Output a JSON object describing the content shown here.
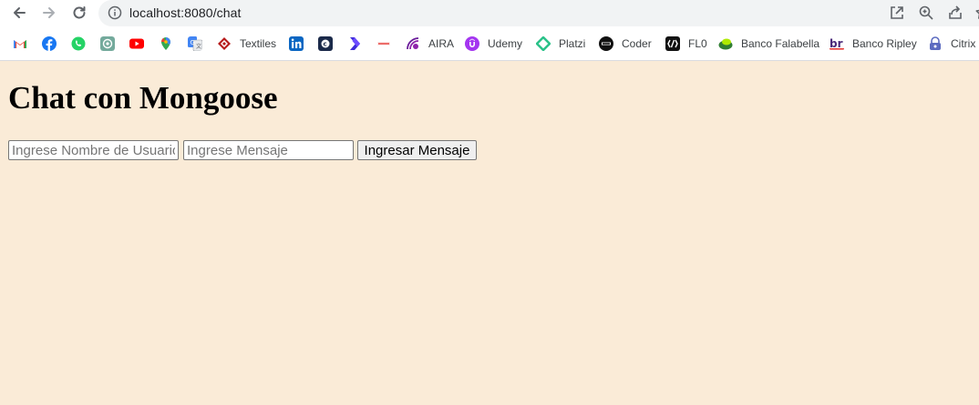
{
  "browser": {
    "url": "localhost:8080/chat",
    "bookmarks": [
      {
        "icon": "gmail-icon",
        "label": ""
      },
      {
        "icon": "facebook-icon",
        "label": ""
      },
      {
        "icon": "whatsapp-icon",
        "label": ""
      },
      {
        "icon": "chatgpt-icon",
        "label": ""
      },
      {
        "icon": "youtube-icon",
        "label": ""
      },
      {
        "icon": "maps-icon",
        "label": ""
      },
      {
        "icon": "translate-icon",
        "label": ""
      },
      {
        "icon": "textiles-icon",
        "label": "Textiles"
      },
      {
        "icon": "linkedin-icon",
        "label": ""
      },
      {
        "icon": "bookmark-app-icon",
        "label": ""
      },
      {
        "icon": "chevron-logo-icon",
        "label": ""
      },
      {
        "icon": "laboral-icon",
        "label": ""
      },
      {
        "icon": "aira-icon",
        "label": "AIRA"
      },
      {
        "icon": "udemy-icon",
        "label": "Udemy"
      },
      {
        "icon": "platzi-icon",
        "label": "Platzi"
      },
      {
        "icon": "coder-icon",
        "label": "Coder"
      },
      {
        "icon": "flo-icon",
        "label": "FL0"
      },
      {
        "icon": "falabella-icon",
        "label": "Banco Falabella"
      },
      {
        "icon": "ripley-icon",
        "label": "Banco Ripley"
      },
      {
        "icon": "citrix-icon",
        "label": "Citrix"
      }
    ]
  },
  "page": {
    "title": "Chat con Mongoose",
    "username_placeholder": "Ingrese Nombre de Usuario",
    "message_placeholder": "Ingrese Mensaje",
    "submit_label": "Ingresar Mensaje"
  },
  "colors": {
    "page_background": "#faebd7",
    "chrome_background": "#ffffff",
    "omnibox_background": "#f1f3f4"
  }
}
